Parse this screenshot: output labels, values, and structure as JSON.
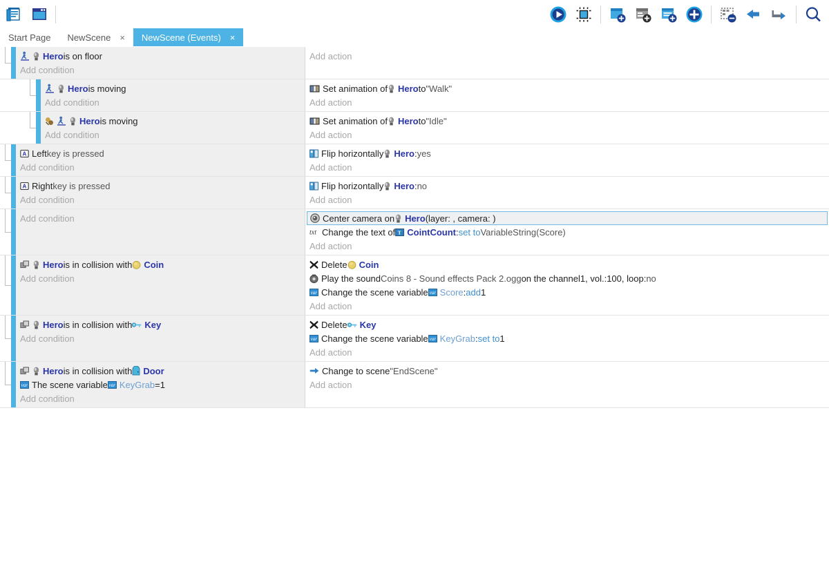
{
  "app": {
    "title": "GDevelop Event Sheet Editor"
  },
  "toolbar": {
    "left_buttons": [
      {
        "name": "project-manager-icon",
        "label": "Project manager"
      },
      {
        "name": "scene-editor-icon",
        "label": "Open scene editor"
      }
    ],
    "right_buttons": [
      {
        "name": "preview-play-icon",
        "label": "Launch a preview"
      },
      {
        "name": "debug-icon",
        "label": "Launch preview with debugger"
      },
      {
        "name": "add-event-icon",
        "label": "Add a new empty event"
      },
      {
        "name": "add-sub-event-icon",
        "label": "Add a sub-event"
      },
      {
        "name": "add-comment-icon",
        "label": "Add a comment"
      },
      {
        "name": "add-condition-icon",
        "label": "Add a new event"
      },
      {
        "name": "remove-event-icon",
        "label": "Delete the selected event(s)"
      },
      {
        "name": "undo-icon",
        "label": "Undo the last changes"
      },
      {
        "name": "redo-icon",
        "label": "Redo the last changes"
      },
      {
        "name": "search-icon",
        "label": "Search in events"
      }
    ]
  },
  "tabs": [
    {
      "label": "Start Page",
      "active": false,
      "closable": false
    },
    {
      "label": "NewScene",
      "active": false,
      "closable": true,
      "close_label": "×"
    },
    {
      "label": "NewScene (Events)",
      "active": true,
      "closable": true,
      "close_label": "×"
    }
  ],
  "placeholders": {
    "add_condition": "Add condition",
    "add_action": "Add action"
  },
  "events": [
    {
      "id": "evt-hero-on-floor",
      "depth": 0,
      "conditions": [
        {
          "icons": [
            "platformer-icon",
            "hero-sprite-icon"
          ],
          "parts": [
            {
              "t": "Hero",
              "k": "obj"
            },
            {
              "t": " is on floor",
              "k": "plain"
            }
          ]
        }
      ],
      "actions": []
    },
    {
      "id": "evt-hero-moving-walk",
      "depth": 1,
      "conditions": [
        {
          "icons": [
            "platformer-icon",
            "hero-sprite-icon"
          ],
          "parts": [
            {
              "t": "Hero",
              "k": "obj"
            },
            {
              "t": " is moving",
              "k": "plain"
            }
          ]
        }
      ],
      "actions": [
        {
          "icons": [
            "animation-icon"
          ],
          "parts": [
            {
              "t": "Set animation of ",
              "k": "plain"
            },
            {
              "t": "ICON:hero-sprite-icon",
              "k": "icon"
            },
            {
              "t": "Hero",
              "k": "obj"
            },
            {
              "t": " to ",
              "k": "plain"
            },
            {
              "t": "\"Walk\"",
              "k": "dim"
            }
          ]
        }
      ]
    },
    {
      "id": "evt-hero-not-moving-idle",
      "depth": 1,
      "conditions": [
        {
          "icons": [
            "invert-condition-icon",
            "platformer-icon",
            "hero-sprite-icon"
          ],
          "parts": [
            {
              "t": "Hero",
              "k": "obj"
            },
            {
              "t": " is moving",
              "k": "plain"
            }
          ]
        }
      ],
      "actions": [
        {
          "icons": [
            "animation-icon"
          ],
          "parts": [
            {
              "t": "Set animation of ",
              "k": "plain"
            },
            {
              "t": "ICON:hero-sprite-icon",
              "k": "icon"
            },
            {
              "t": "Hero",
              "k": "obj"
            },
            {
              "t": " to ",
              "k": "plain"
            },
            {
              "t": "\"Idle\"",
              "k": "dim"
            }
          ]
        }
      ]
    },
    {
      "id": "evt-left-key",
      "depth": 0,
      "conditions": [
        {
          "icons": [
            "keyboard-key-icon"
          ],
          "parts": [
            {
              "t": "Left",
              "k": "plain"
            },
            {
              "t": " key is pressed",
              "k": "dim"
            }
          ]
        }
      ],
      "actions": [
        {
          "icons": [
            "flip-icon"
          ],
          "parts": [
            {
              "t": "Flip horizontally ",
              "k": "plain"
            },
            {
              "t": "ICON:hero-sprite-icon",
              "k": "icon"
            },
            {
              "t": "Hero",
              "k": "obj"
            },
            {
              "t": " : ",
              "k": "plain"
            },
            {
              "t": "yes",
              "k": "dim"
            }
          ]
        }
      ]
    },
    {
      "id": "evt-right-key",
      "depth": 0,
      "conditions": [
        {
          "icons": [
            "keyboard-key-icon"
          ],
          "parts": [
            {
              "t": "Right",
              "k": "plain"
            },
            {
              "t": " key is pressed",
              "k": "dim"
            }
          ]
        }
      ],
      "actions": [
        {
          "icons": [
            "flip-icon"
          ],
          "parts": [
            {
              "t": "Flip horizontally ",
              "k": "plain"
            },
            {
              "t": "ICON:hero-sprite-icon",
              "k": "icon"
            },
            {
              "t": "Hero",
              "k": "obj"
            },
            {
              "t": " : ",
              "k": "plain"
            },
            {
              "t": "no",
              "k": "dim"
            }
          ]
        }
      ]
    },
    {
      "id": "evt-camera-and-text",
      "depth": 0,
      "conditions": [],
      "actions": [
        {
          "selected": true,
          "icons": [
            "camera-icon"
          ],
          "parts": [
            {
              "t": "Center camera on ",
              "k": "plain"
            },
            {
              "t": "ICON:hero-sprite-icon",
              "k": "icon"
            },
            {
              "t": "Hero",
              "k": "obj"
            },
            {
              "t": " (layer: , camera: )",
              "k": "plain"
            }
          ]
        },
        {
          "icons": [
            "text-icon"
          ],
          "parts": [
            {
              "t": "Change the text of ",
              "k": "plain"
            },
            {
              "t": "ICON:text-object-icon",
              "k": "icon"
            },
            {
              "t": "CointCount",
              "k": "obj"
            },
            {
              "t": ": ",
              "k": "plain"
            },
            {
              "t": "set to",
              "k": "op"
            },
            {
              "t": " VariableString(Score)",
              "k": "dim"
            }
          ]
        }
      ]
    },
    {
      "id": "evt-coin-collision",
      "depth": 0,
      "conditions": [
        {
          "icons": [
            "collision-icon",
            "hero-sprite-icon"
          ],
          "parts": [
            {
              "t": "Hero",
              "k": "obj"
            },
            {
              "t": " is in collision with ",
              "k": "plain"
            },
            {
              "t": "ICON:coin-icon",
              "k": "icon"
            },
            {
              "t": "Coin",
              "k": "obj"
            }
          ]
        }
      ],
      "actions": [
        {
          "icons": [
            "delete-icon"
          ],
          "parts": [
            {
              "t": "Delete ",
              "k": "plain"
            },
            {
              "t": "ICON:coin-icon",
              "k": "icon"
            },
            {
              "t": "Coin",
              "k": "obj"
            }
          ]
        },
        {
          "icons": [
            "sound-icon"
          ],
          "parts": [
            {
              "t": "Play the sound ",
              "k": "plain"
            },
            {
              "t": "Coins 8 - Sound effects Pack 2.ogg",
              "k": "dim"
            },
            {
              "t": " on the channel ",
              "k": "plain"
            },
            {
              "t": "1",
              "k": "plain"
            },
            {
              "t": ", vol.: ",
              "k": "plain"
            },
            {
              "t": "100",
              "k": "plain"
            },
            {
              "t": ", loop: ",
              "k": "plain"
            },
            {
              "t": "no",
              "k": "dim"
            }
          ]
        },
        {
          "icons": [
            "variable-icon"
          ],
          "parts": [
            {
              "t": "Change the scene variable ",
              "k": "plain"
            },
            {
              "t": "ICON:variable-small-icon",
              "k": "icon"
            },
            {
              "t": "Score",
              "k": "var"
            },
            {
              "t": ": ",
              "k": "plain"
            },
            {
              "t": "add",
              "k": "op"
            },
            {
              "t": " 1",
              "k": "plain"
            }
          ]
        }
      ]
    },
    {
      "id": "evt-key-collision",
      "depth": 0,
      "conditions": [
        {
          "icons": [
            "collision-icon",
            "hero-sprite-icon"
          ],
          "parts": [
            {
              "t": "Hero",
              "k": "obj"
            },
            {
              "t": " is in collision with ",
              "k": "plain"
            },
            {
              "t": "ICON:key-icon",
              "k": "icon"
            },
            {
              "t": "Key",
              "k": "obj"
            }
          ]
        }
      ],
      "actions": [
        {
          "icons": [
            "delete-icon"
          ],
          "parts": [
            {
              "t": "Delete ",
              "k": "plain"
            },
            {
              "t": "ICON:key-icon",
              "k": "icon"
            },
            {
              "t": "Key",
              "k": "obj"
            }
          ]
        },
        {
          "icons": [
            "variable-icon"
          ],
          "parts": [
            {
              "t": "Change the scene variable ",
              "k": "plain"
            },
            {
              "t": "ICON:variable-small-icon",
              "k": "icon"
            },
            {
              "t": "KeyGrab",
              "k": "var"
            },
            {
              "t": ": ",
              "k": "plain"
            },
            {
              "t": "set to",
              "k": "op"
            },
            {
              "t": " 1",
              "k": "plain"
            }
          ]
        }
      ]
    },
    {
      "id": "evt-door-collision",
      "depth": 0,
      "conditions": [
        {
          "icons": [
            "collision-icon",
            "hero-sprite-icon"
          ],
          "parts": [
            {
              "t": "Hero",
              "k": "obj"
            },
            {
              "t": " is in collision with ",
              "k": "plain"
            },
            {
              "t": "ICON:door-icon",
              "k": "icon"
            },
            {
              "t": "Door",
              "k": "obj"
            }
          ]
        },
        {
          "icons": [
            "variable-icon"
          ],
          "parts": [
            {
              "t": "The scene variable ",
              "k": "plain"
            },
            {
              "t": "ICON:variable-small-icon",
              "k": "icon"
            },
            {
              "t": "KeyGrab",
              "k": "var"
            },
            {
              "t": " = ",
              "k": "plain"
            },
            {
              "t": "1",
              "k": "plain"
            }
          ]
        }
      ],
      "actions": [
        {
          "icons": [
            "scene-change-icon"
          ],
          "parts": [
            {
              "t": "Change to scene ",
              "k": "plain"
            },
            {
              "t": "\"EndScene\"",
              "k": "dim"
            }
          ]
        }
      ]
    }
  ],
  "colors": {
    "accent_blue": "#4cb3e4",
    "object_name": "#2a36a8",
    "variable_name": "#6e9fd0",
    "operator": "#3f8fd0",
    "condition_bg": "#efefef",
    "action_bg": "#ffffff",
    "placeholder_text": "#a8a8a8"
  }
}
